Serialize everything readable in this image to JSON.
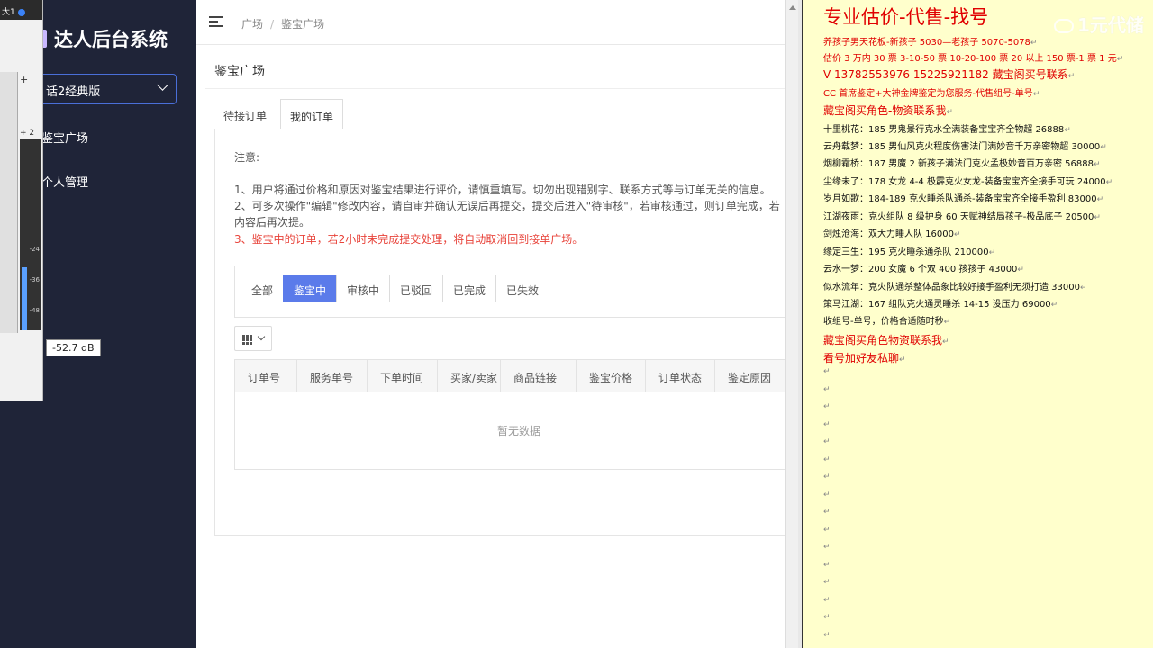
{
  "audio": {
    "top_label": "大1",
    "plus_label": "+",
    "ch_label": "+ 2",
    "tooltip": "-52.7 dB",
    "scale": [
      "-24",
      "-36",
      "-48"
    ]
  },
  "sidebar": {
    "logo": "达人后台系统",
    "version": "话2经典版",
    "items": [
      "鉴宝广场",
      "个人管理"
    ]
  },
  "breadcrumb": {
    "home": "广场",
    "sep": "/",
    "current": "鉴宝广场"
  },
  "page_title": "鉴宝广场",
  "tabs": [
    "待接订单",
    "我的订单"
  ],
  "notes": {
    "heading": "注意:",
    "lines": [
      "1、用户将通过价格和原因对鉴宝结果进行评价，请慎重填写。切勿出现错别字、联系方式等与订单无关的信息。",
      "2、可多次操作\"编辑\"修改内容，请自审并确认无误后再提交，提交后进入\"待审核\"，若审核通过，则订单完成，若",
      "内容后再次提。"
    ],
    "warning": "3、鉴宝中的订单，若2小时未完成提交处理，将自动取消回到接单广场。"
  },
  "filters": [
    "全部",
    "鉴宝中",
    "审核中",
    "已驳回",
    "已完成",
    "已失效"
  ],
  "filter_active_index": 1,
  "table": {
    "columns": [
      "订单号",
      "服务单号",
      "下单时间",
      "买家/卖家",
      "商品链接",
      "鉴宝价格",
      "订单状态",
      "鉴定原因"
    ],
    "empty": "暂无数据"
  },
  "notepad": {
    "title": "专业估价-代售-找号",
    "lines": [
      {
        "text": "养孩子男天花板-新孩子 5030—老孩子 5070-5078",
        "red": true,
        "big": false
      },
      {
        "text": "估价 3 万内 30 票  3-10-50 票  10-20-100 票  20 以上 150 票-1 票 1 元",
        "red": true,
        "big": false
      },
      {
        "text": "V 13782553976    15225921182  藏宝阁买号联系",
        "red": true,
        "big": true
      },
      {
        "text": "CC 首席鉴定+大神金牌鉴定为您服务-代售组号-单号",
        "red": true,
        "big": false
      },
      {
        "text": "藏宝阁买角色-物资联系我",
        "red": true,
        "big": true
      },
      {
        "text": "十里桃花：185 男鬼景行克水全满装备宝宝齐全物超 26888",
        "red": false,
        "big": false
      },
      {
        "text": "云舟载梦：185 男仙风克火程度伤害法门满妙音千万亲密物超 30000",
        "red": false,
        "big": false
      },
      {
        "text": "烟柳霜桥：187 男魔 2 新孩子满法门克火孟极妙音百万亲密 56888",
        "red": false,
        "big": false
      },
      {
        "text": "尘缘未了：178 女龙 4-4 极霹克火女龙-装备宝宝齐全接手可玩 24000",
        "red": false,
        "big": false
      },
      {
        "text": "岁月如歌：184-189 克火睡杀队通杀-装备宝宝齐全接手盈利 83000",
        "red": false,
        "big": false
      },
      {
        "text": "江湖夜雨：克火组队 8 级护身 60 天赋神结局孩子-极品底子 20500",
        "red": false,
        "big": false
      },
      {
        "text": "剑烛沧海：双大力睡人队 16000",
        "red": false,
        "big": false
      },
      {
        "text": "缘定三生：195 克火睡杀通杀队 210000",
        "red": false,
        "big": false
      },
      {
        "text": "云水一梦：200 女魔 6 个双 400 孩孩子 43000",
        "red": false,
        "big": false
      },
      {
        "text": "似水流年：克火队通杀整体品象比较好接手盈利无须打造 33000",
        "red": false,
        "big": false
      },
      {
        "text": "策马江湖：167 组队克火通灵睡杀 14-15 没压力 69000",
        "red": false,
        "big": false
      },
      {
        "text": "收组号-单号，价格合适随时秒",
        "red": false,
        "big": false
      },
      {
        "text": "藏宝阁买角色物资联系我",
        "red": true,
        "big": true
      },
      {
        "text": "看号加好友私聊",
        "red": true,
        "big": true
      }
    ],
    "para_mark": "↵"
  },
  "watermark": "1元代储"
}
